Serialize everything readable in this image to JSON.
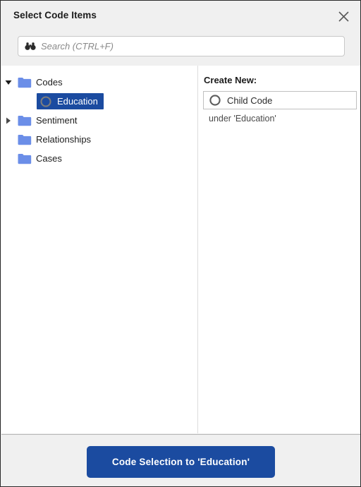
{
  "dialog": {
    "title": "Select Code Items",
    "close_icon": "close-icon"
  },
  "search": {
    "icon": "binoculars-icon",
    "placeholder": "Search (CTRL+F)",
    "value": ""
  },
  "tree": {
    "items": [
      {
        "label": "Codes",
        "icon": "folder-icon",
        "twisty": "chevron-down-icon",
        "expanded": true,
        "depth": 0,
        "selected": false
      },
      {
        "label": "Education",
        "icon": "code-circle-icon",
        "twisty": "",
        "expanded": false,
        "depth": 1,
        "selected": true
      },
      {
        "label": "Sentiment",
        "icon": "folder-icon",
        "twisty": "chevron-right-icon",
        "expanded": false,
        "depth": 0,
        "selected": false
      },
      {
        "label": "Relationships",
        "icon": "folder-icon",
        "twisty": "",
        "expanded": false,
        "depth": 0,
        "selected": false
      },
      {
        "label": "Cases",
        "icon": "folder-icon",
        "twisty": "",
        "expanded": false,
        "depth": 0,
        "selected": false
      }
    ]
  },
  "create_new": {
    "heading": "Create New:",
    "child_code_label": "Child Code",
    "child_code_icon": "code-circle-icon",
    "under_label": "under 'Education'"
  },
  "footer": {
    "primary_button": "Code Selection to 'Education'"
  },
  "colors": {
    "accent": "#1b4ba0",
    "folder": "#6b8ee8",
    "chrome": "#f0f0f0",
    "border": "#2b2b2b"
  }
}
